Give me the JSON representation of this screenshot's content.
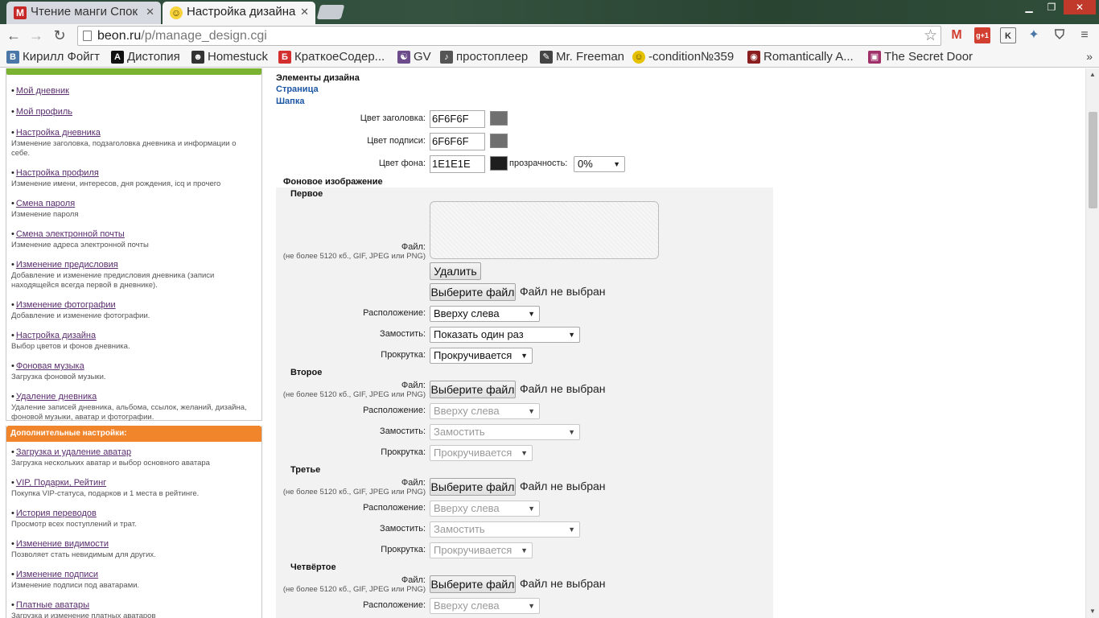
{
  "browser": {
    "tabs": [
      {
        "title": "Чтение манги Спок",
        "favicon": "M",
        "active": false
      },
      {
        "title": "Настройка дизайна",
        "favicon": "☺",
        "active": true
      }
    ],
    "url_host": "beon.ru",
    "url_path": "/p/manage_design.cgi",
    "extensions": [
      "gmail-icon",
      "gplus-icon",
      "k-icon",
      "share-icon",
      "pocket-icon",
      "menu-icon"
    ],
    "ext_labels": {
      "gplus": "g+1",
      "k": "K"
    },
    "bookmarks": [
      {
        "label": "Кирилл Фойгт",
        "icon": "В",
        "color": "#4a76a8"
      },
      {
        "label": "Дистопия",
        "icon": "A",
        "color": "#111111"
      },
      {
        "label": "Homestuck",
        "icon": "☻",
        "color": "#333333"
      },
      {
        "label": "КраткоеСодер...",
        "icon": "Б",
        "color": "#d32f2f"
      },
      {
        "label": "GV",
        "icon": "☯",
        "color": "#6d4c8c"
      },
      {
        "label": "простоплеер",
        "icon": "♪",
        "color": "#555555"
      },
      {
        "label": "Mr. Freeman",
        "icon": "✎",
        "color": "#444444"
      },
      {
        "label": "-condition№359",
        "icon": "☺",
        "color": "#e5c100"
      },
      {
        "label": "Romantically A...",
        "icon": "◉",
        "color": "#8a1d1d"
      },
      {
        "label": "The Secret Door",
        "icon": "▣",
        "color": "#a0306a"
      }
    ]
  },
  "sidebar": {
    "items": [
      {
        "link": "Мой дневник",
        "desc": ""
      },
      {
        "link": "Мой профиль",
        "desc": ""
      },
      {
        "link": "Настройка дневника",
        "desc": "Изменение заголовка, подзаголовка дневника и информации о себе."
      },
      {
        "link": "Настройка профиля",
        "desc": "Изменение имени, интересов, дня рождения, icq и прочего"
      },
      {
        "link": "Смена пароля",
        "desc": "Изменение пароля"
      },
      {
        "link": "Смена электронной почты",
        "desc": "Изменение адреса электронной почты"
      },
      {
        "link": "Изменение предисловия",
        "desc": "Добавление и изменение предисловия дневника (записи находящейся всегда первой в дневнике)."
      },
      {
        "link": "Изменение фотографии",
        "desc": "Добавление и изменение фотографии."
      },
      {
        "link": "Настройка дизайна",
        "desc": "Выбор цветов и фонов дневника."
      },
      {
        "link": "Фоновая музыка",
        "desc": "Загрузка фоновой музыки."
      },
      {
        "link": "Удаление дневника",
        "desc": "Удаление записей дневника, альбома, ссылок, желаний, дизайна, фоновой музыки, аватар и фотографии."
      }
    ],
    "extra_title": "Дополнительные настройки:",
    "extra_items": [
      {
        "link": "Загрузка и удаление аватар",
        "desc": "Загрузка нескольких аватар и выбор основного аватара"
      },
      {
        "link": "VIP, Подарки, Рейтинг",
        "desc": "Покупка VIP-статуса, подарков и 1 места в рейтинге."
      },
      {
        "link": "История переводов",
        "desc": "Просмотр всех поступлений и трат."
      },
      {
        "link": "Изменение видимости",
        "desc": "Позволяет стать невидимым для других."
      },
      {
        "link": "Изменение подписи",
        "desc": "Изменение подписи под аватарами."
      },
      {
        "link": "Платные аватары",
        "desc": "Загрузка и изменение платных аватаров"
      }
    ]
  },
  "main": {
    "heading": "Элементы дизайна",
    "link_page": "Страница",
    "link_header": "Шапка",
    "header_colors": {
      "title_label": "Цвет заголовка:",
      "title_value": "6F6F6F",
      "title_color": "#6f6f6f",
      "caption_label": "Цвет подписи:",
      "caption_value": "6F6F6F",
      "caption_color": "#6f6f6f",
      "bg_label": "Цвет фона:",
      "bg_value": "1E1E1E",
      "bg_color": "#1e1e1e",
      "transparency_label": "прозрачность:",
      "transparency_value": "0%"
    },
    "bg_images": {
      "title": "Фоновое изображение",
      "file_label": "Файл:",
      "file_note": "(не более 5120 кб., GIF, JPEG или PNG)",
      "delete_button": "Удалить",
      "choose_button": "Выберите файл",
      "no_file": "Файл не выбран",
      "position_label": "Расположение:",
      "tile_label": "Замостить:",
      "scroll_label": "Прокрутка:",
      "slots": [
        {
          "name": "Первое",
          "position": "Вверху слева",
          "tile": "Показать один раз",
          "scroll": "Прокручивается"
        },
        {
          "name": "Второе",
          "position": "Вверху слева",
          "tile": "Замостить",
          "scroll": "Прокручивается"
        },
        {
          "name": "Третье",
          "position": "Вверху слева",
          "tile": "Замостить",
          "scroll": "Прокручивается"
        },
        {
          "name": "Четвёртое",
          "position": "Вверху слева"
        }
      ]
    }
  }
}
